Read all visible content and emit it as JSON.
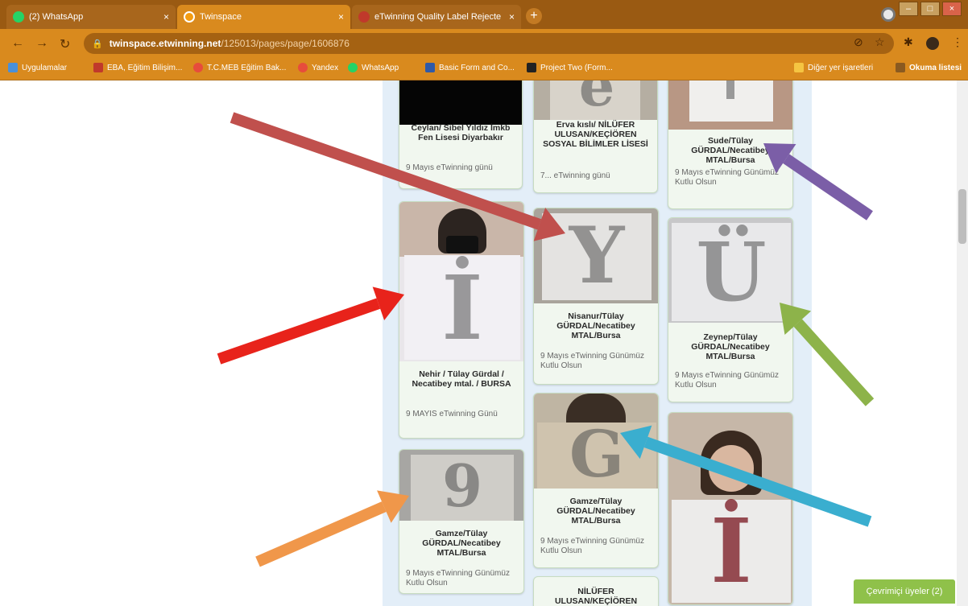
{
  "browser": {
    "tabs": [
      {
        "title": "(2) WhatsApp",
        "color": "#25d366"
      },
      {
        "title": "Twinspace",
        "color": "#f39c12"
      },
      {
        "title": "eTwinning Quality Label Rejecte",
        "color": "#c0392b"
      }
    ],
    "new_tab": "+",
    "address": {
      "host": "twinspace.etwinning.net",
      "path": "/125013/pages/page/1606876"
    },
    "bookmarks": [
      {
        "label": "Uygulamalar",
        "color": "#4a90d9"
      },
      {
        "label": "EBA, Eğitim Bilişim...",
        "color": "#c0392b"
      },
      {
        "label": "T.C.MEB Eğitim Bak...",
        "color": "#e74c3c"
      },
      {
        "label": "Yandex",
        "color": "#e74c3c"
      },
      {
        "label": "WhatsApp",
        "color": "#25d366"
      },
      {
        "label": "Basic Form and Co...",
        "color": "#2f5aa8"
      },
      {
        "label": "Project Two (Form...",
        "color": "#222222"
      }
    ],
    "other_bookmarks": "Diğer yer işaretleri",
    "reading_list": "Okuma listesi"
  },
  "wall": {
    "cards": [
      {
        "title": "Ceylan/ Sibel Yıldız İmkb Fen Lisesi Diyarbakır",
        "subtitle": "9 Mayıs eTwinning günü"
      },
      {
        "title": "Erva kıslı/ NİLÜFER ULUSAN/KEÇİÖREN SOSYAL BİLİMLER LİSESİ",
        "subtitle": "7... eTwinning günü"
      },
      {
        "title": "Sude/Tülay GÜRDAL/Necatibey MTAL/Bursa",
        "subtitle": "9 Mayıs eTwinning Günümüz Kutlu Olsun"
      },
      {
        "title": "Nehir / Tülay Gürdal / Necatibey mtal. / BURSA",
        "subtitle": "9 MAYIS eTwinning Günü",
        "letter": "İ"
      },
      {
        "title": "Nisanur/Tülay GÜRDAL/Necatibey MTAL/Bursa",
        "subtitle": "9 Mayıs eTwinning Günümüz Kutlu Olsun",
        "letter": "Y"
      },
      {
        "title": "Zeynep/Tülay GÜRDAL/Necatibey MTAL/Bursa",
        "subtitle": "9 Mayıs eTwinning Günümüz Kutlu Olsun",
        "letter": "Ü"
      },
      {
        "title": "Gamze/Tülay GÜRDAL/Necatibey MTAL/Bursa",
        "subtitle": "9 Mayıs eTwinning Günümüz Kutlu Olsun",
        "letter": "G"
      },
      {
        "title": "Gamze/Tülay GÜRDAL/Necatibey MTAL/Bursa",
        "subtitle": "9 Mayıs eTwinning Günümüz Kutlu Olsun",
        "letter": "9"
      },
      {
        "title": "NİLÜFER ULUSAN/KEÇİÖREN",
        "subtitle": ""
      },
      {
        "title": "",
        "subtitle": "",
        "letter": "İ"
      }
    ]
  },
  "online_members": "Çevrimiçi üyeler (2)",
  "arrow_colors": [
    "#c0504d",
    "#7b5ea7",
    "#e8231b",
    "#8db34a",
    "#f0974a",
    "#3aaecf"
  ]
}
